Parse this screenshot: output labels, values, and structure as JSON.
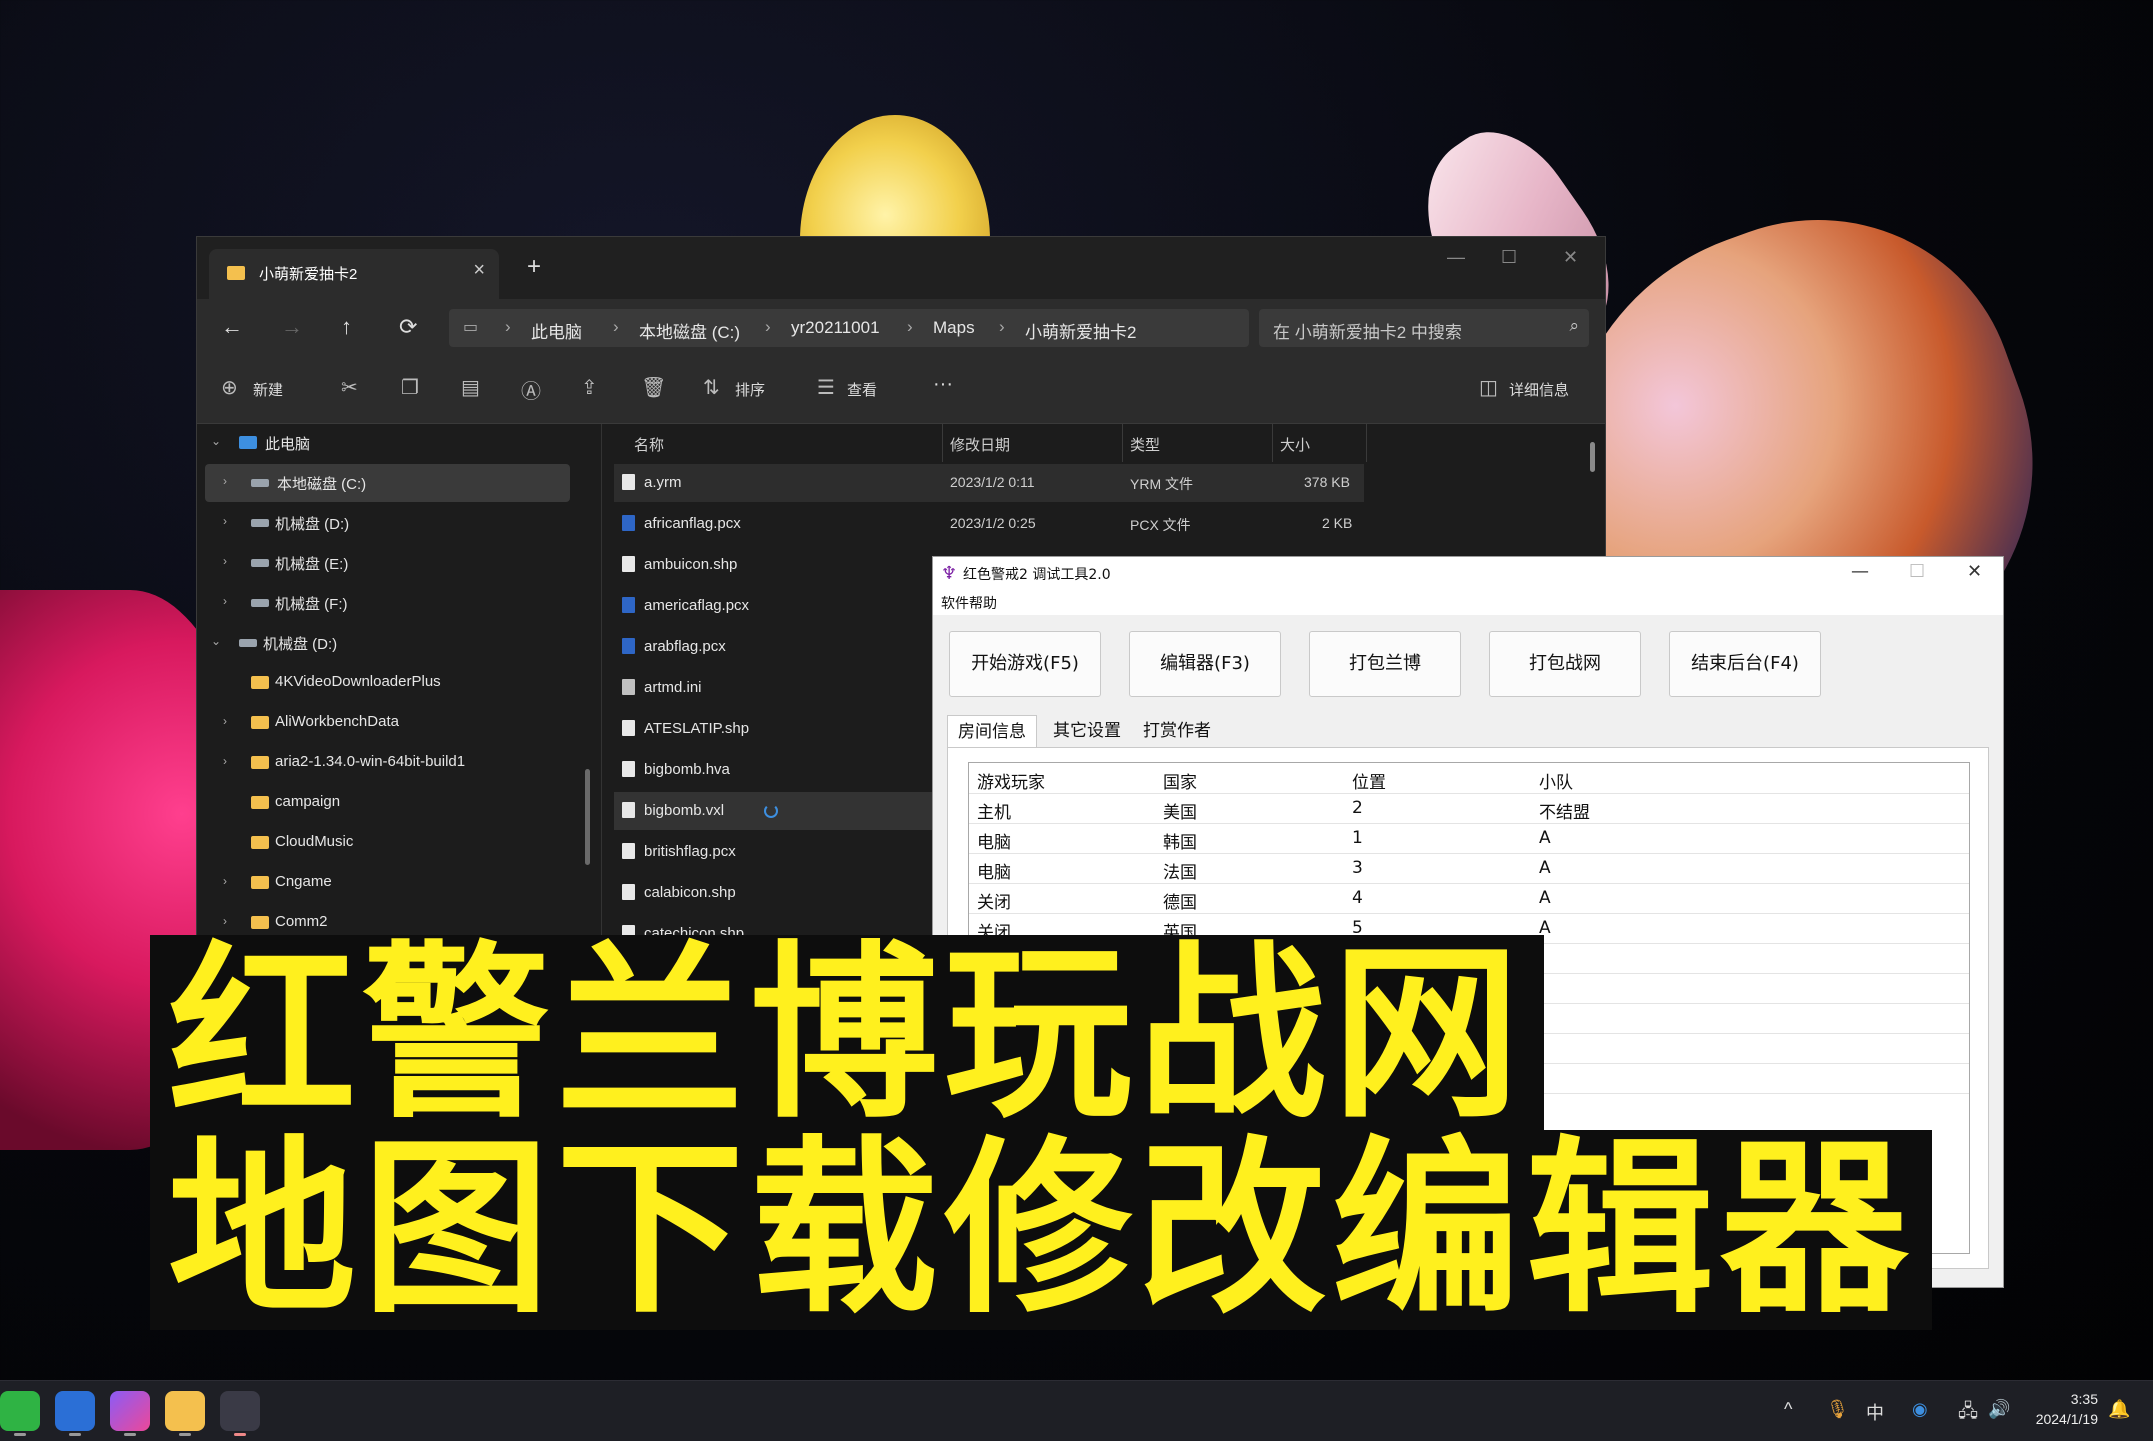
{
  "explorer": {
    "tab_title": "小萌新爱抽卡2",
    "tab_close": "×",
    "new_tab": "+",
    "window_controls": [
      "—",
      "☐",
      "✕"
    ],
    "nav": {
      "back": "←",
      "forward": "→",
      "up": "↑",
      "refresh": "⟳"
    },
    "breadcrumb": [
      "此电脑",
      "本地磁盘 (C:)",
      "yr20211001",
      "Maps",
      "小萌新爱抽卡2"
    ],
    "breadcrumb_sep": "›",
    "search_placeholder": "在 小萌新爱抽卡2 中搜索",
    "toolbar": {
      "new": "新建",
      "sort": "排序",
      "view": "查看",
      "more": "···",
      "details": "详细信息"
    },
    "sidebar": [
      {
        "label": "此电脑",
        "icon": "pc-icon"
      },
      {
        "label": "本地磁盘 (C:)",
        "icon": "drive-icon"
      },
      {
        "label": "机械盘 (D:)",
        "icon": "drive-icon"
      },
      {
        "label": "机械盘 (E:)",
        "icon": "drive-icon"
      },
      {
        "label": "机械盘 (F:)",
        "icon": "drive-icon"
      },
      {
        "label": "机械盘 (D:)",
        "icon": "drive-icon"
      },
      {
        "label": "4KVideoDownloaderPlus",
        "icon": "folder-icon"
      },
      {
        "label": "AliWorkbenchData",
        "icon": "folder-icon"
      },
      {
        "label": "aria2-1.34.0-win-64bit-build1",
        "icon": "folder-icon"
      },
      {
        "label": "campaign",
        "icon": "folder-icon"
      },
      {
        "label": "CloudMusic",
        "icon": "folder-icon"
      },
      {
        "label": "Cngame",
        "icon": "folder-icon"
      },
      {
        "label": "Comm2",
        "icon": "folder-icon"
      }
    ],
    "columns": [
      "名称",
      "修改日期",
      "类型",
      "大小"
    ],
    "files": [
      {
        "name": "a.yrm",
        "date": "2023/1/2 0:11",
        "type": "YRM 文件",
        "size": "378 KB"
      },
      {
        "name": "africanflag.pcx",
        "date": "2023/1/2 0:25",
        "type": "PCX 文件",
        "size": "2 KB"
      },
      {
        "name": "ambuicon.shp"
      },
      {
        "name": "americaflag.pcx"
      },
      {
        "name": "arabflag.pcx"
      },
      {
        "name": "artmd.ini"
      },
      {
        "name": "ATESLATIP.shp"
      },
      {
        "name": "bigbomb.hva"
      },
      {
        "name": "bigbomb.vxl"
      },
      {
        "name": "britishflag.pcx"
      },
      {
        "name": "calabicon.shp"
      },
      {
        "name": "catechicon.shp"
      }
    ]
  },
  "tool": {
    "title": "红色警戒2 调试工具2.0",
    "menu": "软件帮助",
    "buttons": [
      "开始游戏(F5)",
      "编辑器(F3)",
      "打包兰博",
      "打包战网",
      "结束后台(F4)"
    ],
    "tabs": [
      "房间信息",
      "其它设置",
      "打赏作者"
    ],
    "grid_headers": [
      "游戏玩家",
      "国家",
      "位置",
      "小队"
    ],
    "grid_rows": [
      [
        "主机",
        "美国",
        "2",
        "不结盟"
      ],
      [
        "电脑",
        "韩国",
        "1",
        "A"
      ],
      [
        "电脑",
        "法国",
        "3",
        "A"
      ],
      [
        "关闭",
        "德国",
        "4",
        "A"
      ],
      [
        "关闭",
        "英国",
        "5",
        "A"
      ]
    ]
  },
  "caption": {
    "line1": "红警兰博玩战网",
    "line2": "地图下载修改编辑器"
  },
  "taskbar": {
    "tray": {
      "chevron": "^",
      "ime": "中"
    },
    "time": "3:35",
    "date": "2024/1/19"
  }
}
